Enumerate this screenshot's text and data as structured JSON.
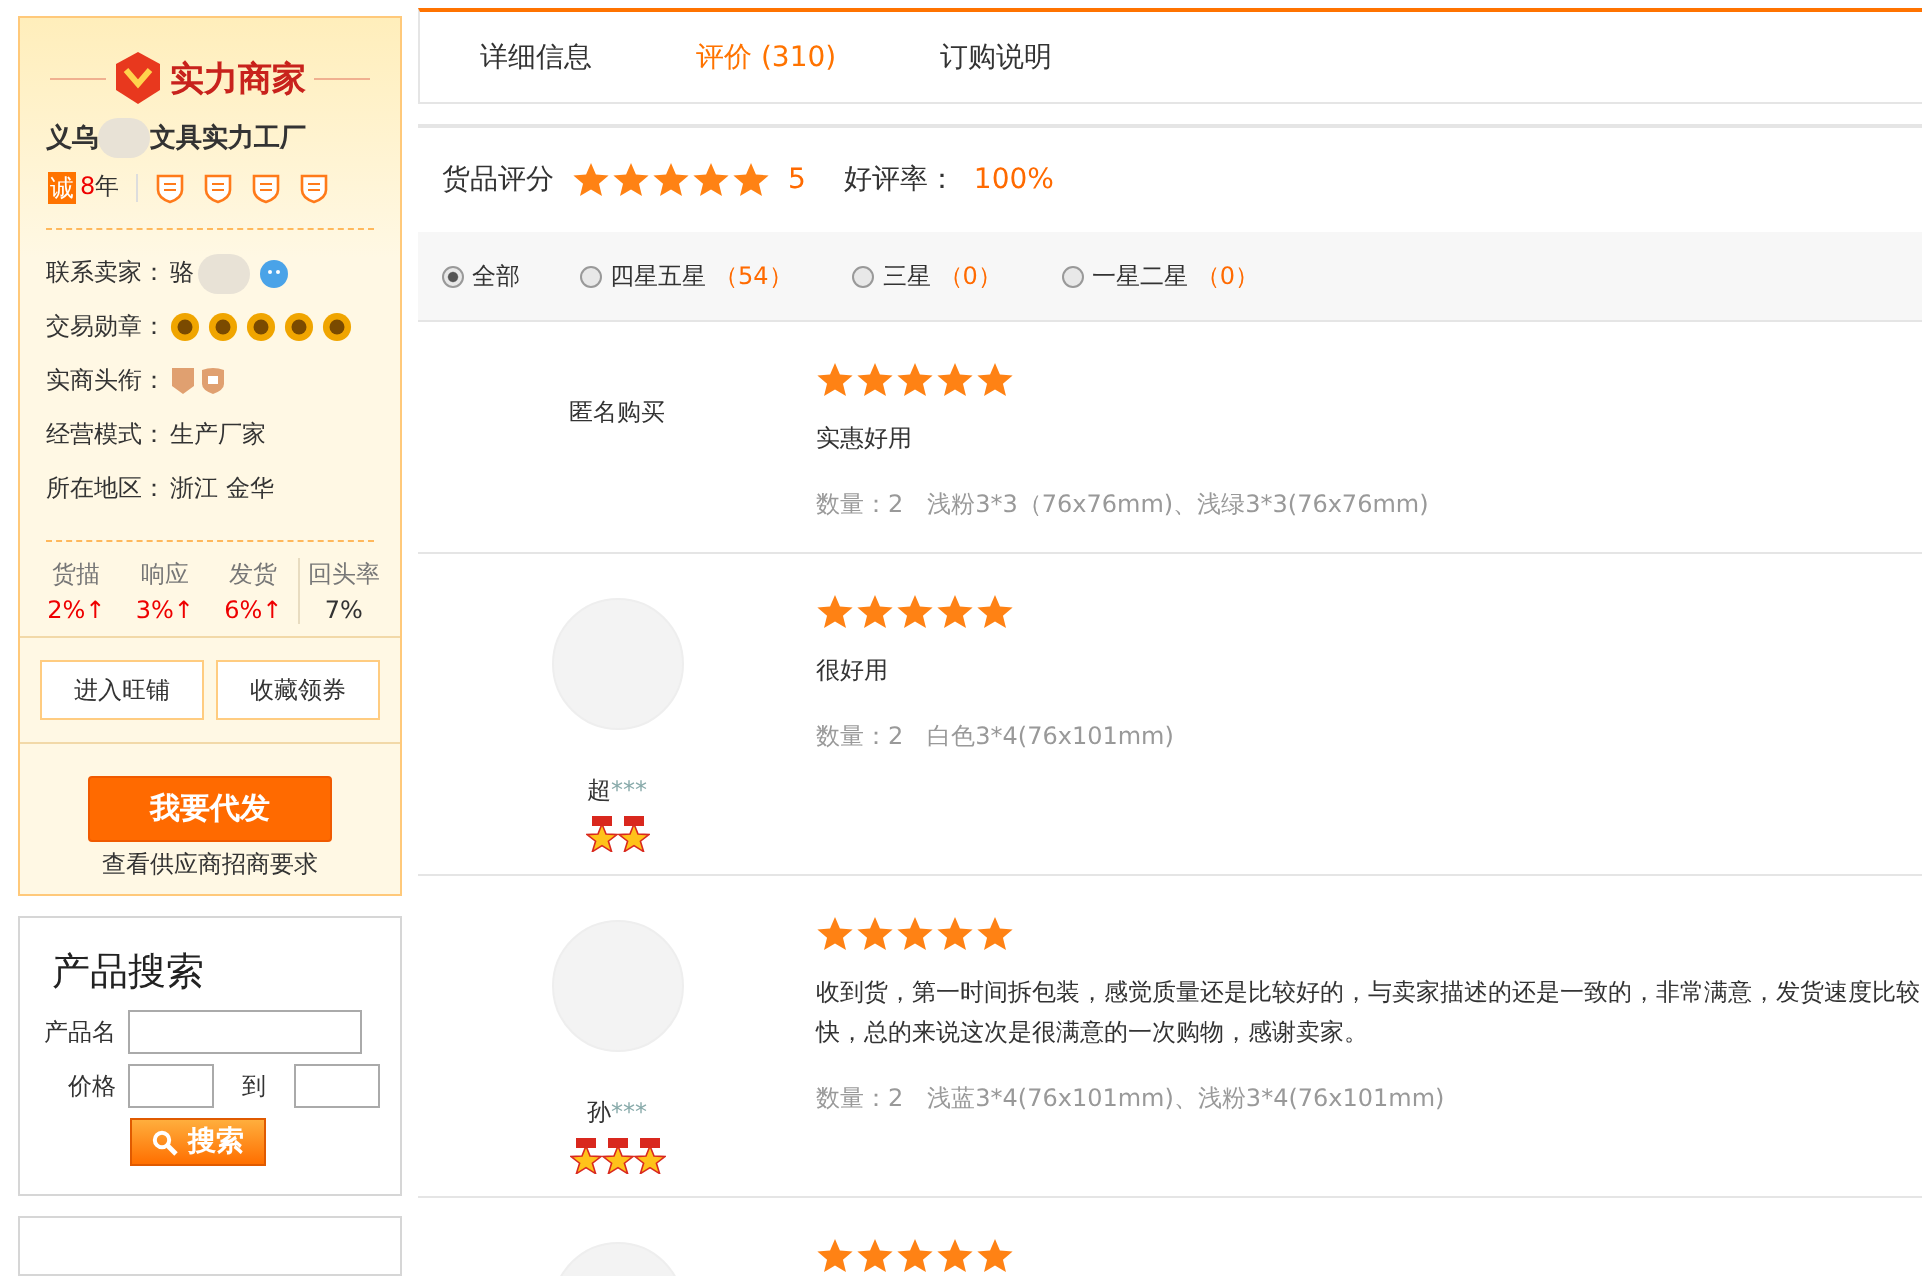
{
  "seller": {
    "brand": "实力商家",
    "name_start": "义乌",
    "name_end": "文具实力工厂",
    "integrity": "诚",
    "years_num": "8",
    "years_unit": "年",
    "info": [
      {
        "label": "联系卖家：",
        "kind": "contact",
        "value": "骆"
      },
      {
        "label": "交易勋章：",
        "kind": "medals",
        "medals": [
          {
            "kind": "gold"
          },
          {
            "kind": "gold"
          },
          {
            "kind": "gold"
          },
          {
            "kind": "gold"
          },
          {
            "kind": "gold"
          }
        ]
      },
      {
        "label": "实商头衔：",
        "kind": "titles"
      },
      {
        "label": "经营模式：",
        "kind": "text",
        "value": "生产厂家"
      },
      {
        "label": "所在地区：",
        "kind": "text",
        "value": "浙江 金华"
      }
    ],
    "stats": [
      {
        "label": "货描",
        "value": "2%↑",
        "up": true
      },
      {
        "label": "响应",
        "value": "3%↑",
        "up": true
      },
      {
        "label": "发货",
        "value": "6%↑",
        "up": true
      },
      {
        "label": "回头率",
        "value": "7%",
        "up": false
      }
    ],
    "buttons": [
      "进入旺铺",
      "收藏领券"
    ],
    "cta": "我要代发",
    "cta_link": "查看供应商招商要求"
  },
  "search": {
    "title": "产品搜索",
    "name_label": "产品名",
    "price_label": "价格",
    "to_label": "到",
    "button": "搜索"
  },
  "tabs": [
    {
      "label": "详细信息",
      "selected": false
    },
    {
      "label": "评价 (310)",
      "selected": true
    },
    {
      "label": "订购说明",
      "selected": false
    }
  ],
  "score": {
    "label": "货品评分",
    "stars": 5,
    "value": "5",
    "rate_label": "好评率：",
    "rate": "100%"
  },
  "filters": [
    {
      "label": "全部",
      "selected": true
    },
    {
      "label": "四星五星",
      "count": "（54）",
      "selected": false
    },
    {
      "label": "三星",
      "count": "（0）",
      "selected": false
    },
    {
      "label": "一星二星",
      "count": "（0）",
      "selected": false
    }
  ],
  "reviews": [
    {
      "buyer": "匿名购买",
      "anonymous": true,
      "stars": 5,
      "text": "实惠好用",
      "qty_label": "数量：",
      "qty": "2",
      "spec": "浅粉3*3（76x76mm)、浅绿3*3(76x76mm)"
    },
    {
      "buyer": "超",
      "buyer_mask": "***",
      "anonymous": false,
      "medals": [
        {
          "kind": "star"
        },
        {
          "kind": "star"
        }
      ],
      "stars": 5,
      "text": "很好用",
      "qty_label": "数量：",
      "qty": "2",
      "spec": "白色3*4(76x101mm)"
    },
    {
      "buyer": "孙",
      "buyer_mask": "***",
      "anonymous": false,
      "medals": [
        {
          "kind": "star"
        },
        {
          "kind": "star"
        },
        {
          "kind": "star"
        }
      ],
      "stars": 5,
      "text": "收到货，第一时间拆包装，感觉质量还是比较好的，与卖家描述的还是一致的，非常满意，发货速度比较快，总的来说这次是很满意的一次购物，感谢卖家。",
      "qty_label": "数量：",
      "qty": "2",
      "spec": "浅蓝3*4(76x101mm)、浅粉3*4(76x101mm)"
    },
    {
      "anonymous": false,
      "stars": 5
    }
  ]
}
